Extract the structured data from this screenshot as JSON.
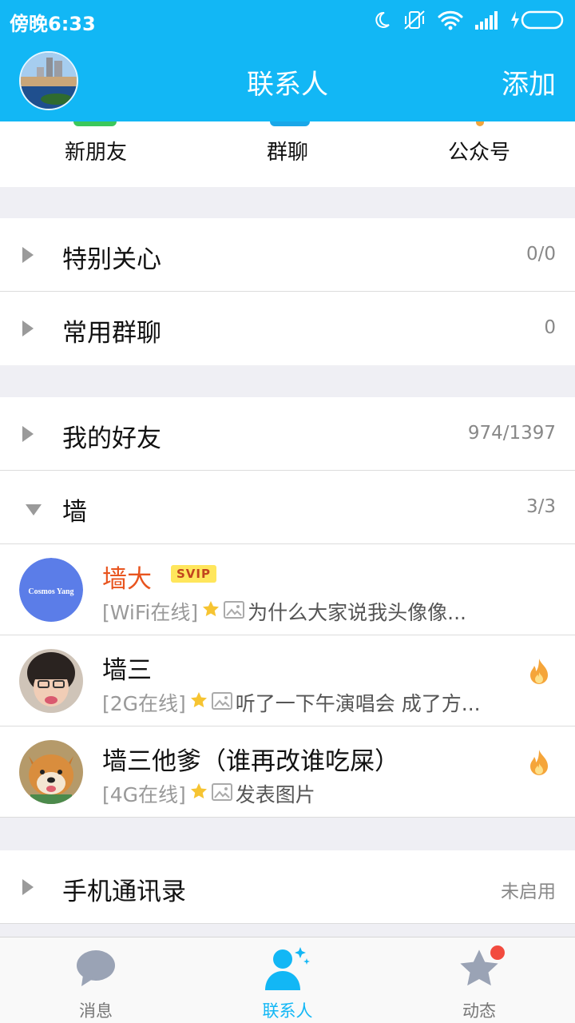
{
  "status_bar": {
    "time": "傍晚6:33"
  },
  "header": {
    "title": "联系人",
    "add_label": "添加"
  },
  "quick_entries": [
    {
      "label": "新朋友"
    },
    {
      "label": "群聊"
    },
    {
      "label": "公众号"
    }
  ],
  "groups": {
    "special_care": {
      "label": "特别关心",
      "count": "0/0"
    },
    "frequent_groups": {
      "label": "常用群聊",
      "count": "0"
    },
    "my_friends": {
      "label": "我的好友",
      "count": "974/1397"
    },
    "wall": {
      "label": "墙",
      "count": "3/3"
    },
    "phone_contacts": {
      "label": "手机通讯录",
      "count": "未启用"
    }
  },
  "friends": [
    {
      "name": "墙大",
      "badge": "SVIP",
      "status": "[WiFi在线]",
      "mood": "为什么大家说我头像像...",
      "avatar_text": "Cosmos Yang",
      "avatar_color": "#5b7de8"
    },
    {
      "name": "墙三",
      "status": "[2G在线]",
      "mood": "听了一下午演唱会 成了方...",
      "has_flame": true
    },
    {
      "name": "墙三他爹（谁再改谁吃屎）",
      "status": "[4G在线]",
      "mood": "发表图片",
      "has_flame": true
    }
  ],
  "tabbar": {
    "tabs": [
      {
        "label": "消息"
      },
      {
        "label": "联系人"
      },
      {
        "label": "动态"
      }
    ]
  },
  "colors": {
    "accent": "#12b7f5",
    "vip_name": "#e8541e",
    "badge": "#ffe65c",
    "notification": "#f24b3f"
  }
}
